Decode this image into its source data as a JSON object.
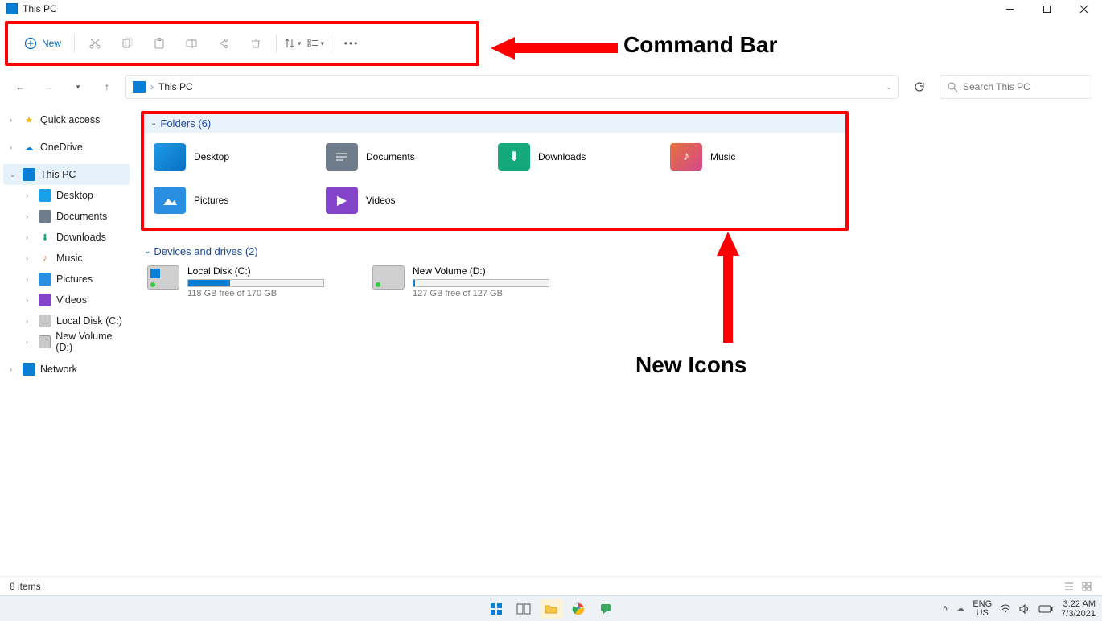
{
  "window": {
    "title": "This PC"
  },
  "cmdbar": {
    "new_label": "New"
  },
  "annotations": {
    "command_bar": "Command Bar",
    "new_icons": "New Icons"
  },
  "address": {
    "path": "This PC"
  },
  "search": {
    "placeholder": "Search This PC"
  },
  "sidebar": {
    "quick_access": "Quick access",
    "onedrive": "OneDrive",
    "this_pc": "This PC",
    "children": {
      "desktop": "Desktop",
      "documents": "Documents",
      "downloads": "Downloads",
      "music": "Music",
      "pictures": "Pictures",
      "videos": "Videos",
      "local_disk": "Local Disk (C:)",
      "new_volume": "New Volume (D:)"
    },
    "network": "Network"
  },
  "groups": {
    "folders_header": "Folders (6)",
    "drives_header": "Devices and drives (2)"
  },
  "folders": {
    "desktop": "Desktop",
    "documents": "Documents",
    "downloads": "Downloads",
    "music": "Music",
    "pictures": "Pictures",
    "videos": "Videos"
  },
  "drives": {
    "c": {
      "name": "Local Disk (C:)",
      "free_text": "118 GB free of 170 GB",
      "fill_pct": 31
    },
    "d": {
      "name": "New Volume (D:)",
      "free_text": "127 GB free of 127 GB",
      "fill_pct": 1
    }
  },
  "status": {
    "items": "8 items"
  },
  "taskbar": {
    "lang1": "ENG",
    "lang2": "US",
    "time": "3:22 AM",
    "date": "7/3/2021"
  }
}
